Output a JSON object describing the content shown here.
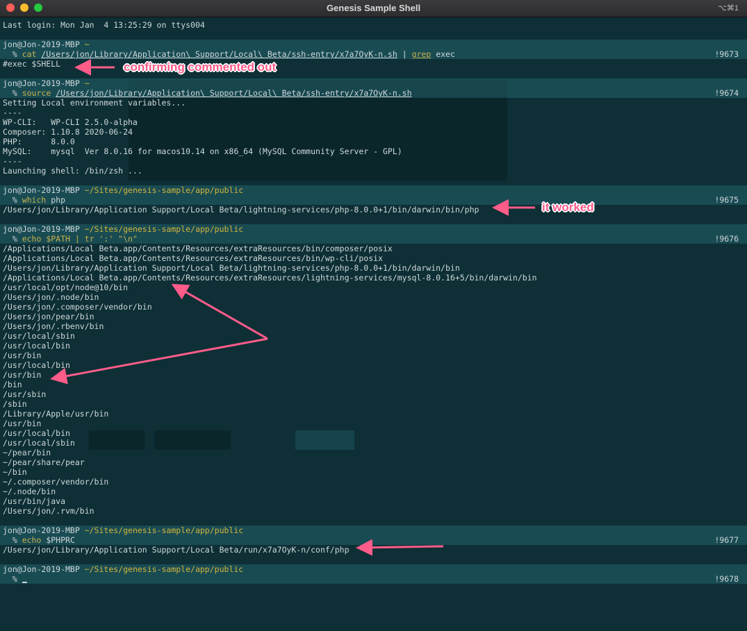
{
  "window": {
    "title": "Genesis Sample Shell",
    "shortcut": "⌥⌘1"
  },
  "terminal": {
    "last_login": "Last login: Mon Jan  4 13:25:29 on ttys004",
    "user_host": "jon@Jon-2019-MBP",
    "blocks": [
      {
        "cwd": "~",
        "number": "!9673",
        "cmd": "cat",
        "arg": "/Users/jon/Library/Application\\ Support/Local\\ Beta/ssh-entry/x7a7OyK-n.sh",
        "pipe": " | ",
        "cmd2": "grep",
        "arg2": " exec",
        "output": [
          "#exec $SHELL"
        ]
      },
      {
        "cwd": "~",
        "number": "!9674",
        "cmd": "source",
        "arg": "/Users/jon/Library/Application\\ Support/Local\\ Beta/ssh-entry/x7a7OyK-n.sh",
        "output": [
          "Setting Local environment variables...",
          "----",
          "WP-CLI:   WP-CLI 2.5.0-alpha",
          "Composer: 1.10.8 2020-06-24",
          "PHP:      8.0.0",
          "MySQL:    mysql  Ver 8.0.16 for macos10.14 on x86_64 (MySQL Community Server - GPL)",
          "----",
          "Launching shell: /bin/zsh ..."
        ]
      },
      {
        "cwd": "~/Sites/genesis-sample/app/public",
        "number": "!9675",
        "cmd": "which",
        "arg": " php",
        "output": [
          "/Users/jon/Library/Application Support/Local Beta/lightning-services/php-8.0.0+1/bin/darwin/bin/php"
        ]
      },
      {
        "cwd": "~/Sites/genesis-sample/app/public",
        "number": "!9676",
        "cmd": "echo $PATH | tr ':' \"\\n\"",
        "arg": "",
        "output": [
          "/Applications/Local Beta.app/Contents/Resources/extraResources/bin/composer/posix",
          "/Applications/Local Beta.app/Contents/Resources/extraResources/bin/wp-cli/posix",
          "/Users/jon/Library/Application Support/Local Beta/lightning-services/php-8.0.0+1/bin/darwin/bin",
          "/Applications/Local Beta.app/Contents/Resources/extraResources/lightning-services/mysql-8.0.16+5/bin/darwin/bin",
          "/usr/local/opt/node@10/bin",
          "/Users/jon/.node/bin",
          "/Users/jon/.composer/vendor/bin",
          "/Users/jon/pear/bin",
          "/Users/jon/.rbenv/bin",
          "/usr/local/sbin",
          "/usr/local/bin",
          "/usr/bin",
          "/usr/local/bin",
          "/usr/bin",
          "/bin",
          "/usr/sbin",
          "/sbin",
          "/Library/Apple/usr/bin",
          "/usr/bin",
          "/usr/local/bin",
          "/usr/local/sbin",
          "~/pear/bin",
          "~/pear/share/pear",
          "~/bin",
          "~/.composer/vendor/bin",
          "~/.node/bin",
          "/usr/bin/java",
          "/Users/jon/.rvm/bin"
        ]
      },
      {
        "cwd": "~/Sites/genesis-sample/app/public",
        "number": "!9677",
        "cmd": "echo",
        "arg": " $PHPRC",
        "output": [
          "/Users/jon/Library/Application Support/Local Beta/run/x7a7OyK-n/conf/php"
        ]
      },
      {
        "cwd": "~/Sites/genesis-sample/app/public",
        "number": "!9678",
        "cmd": "",
        "arg": "",
        "output": []
      }
    ],
    "prompt_symbol": "%"
  },
  "annotations": {
    "a1": "confirming commented out",
    "a2": "it worked"
  },
  "colors": {
    "bg": "#0d2f35",
    "path": "#d2b63b",
    "annotation": "#ff5c8a"
  }
}
